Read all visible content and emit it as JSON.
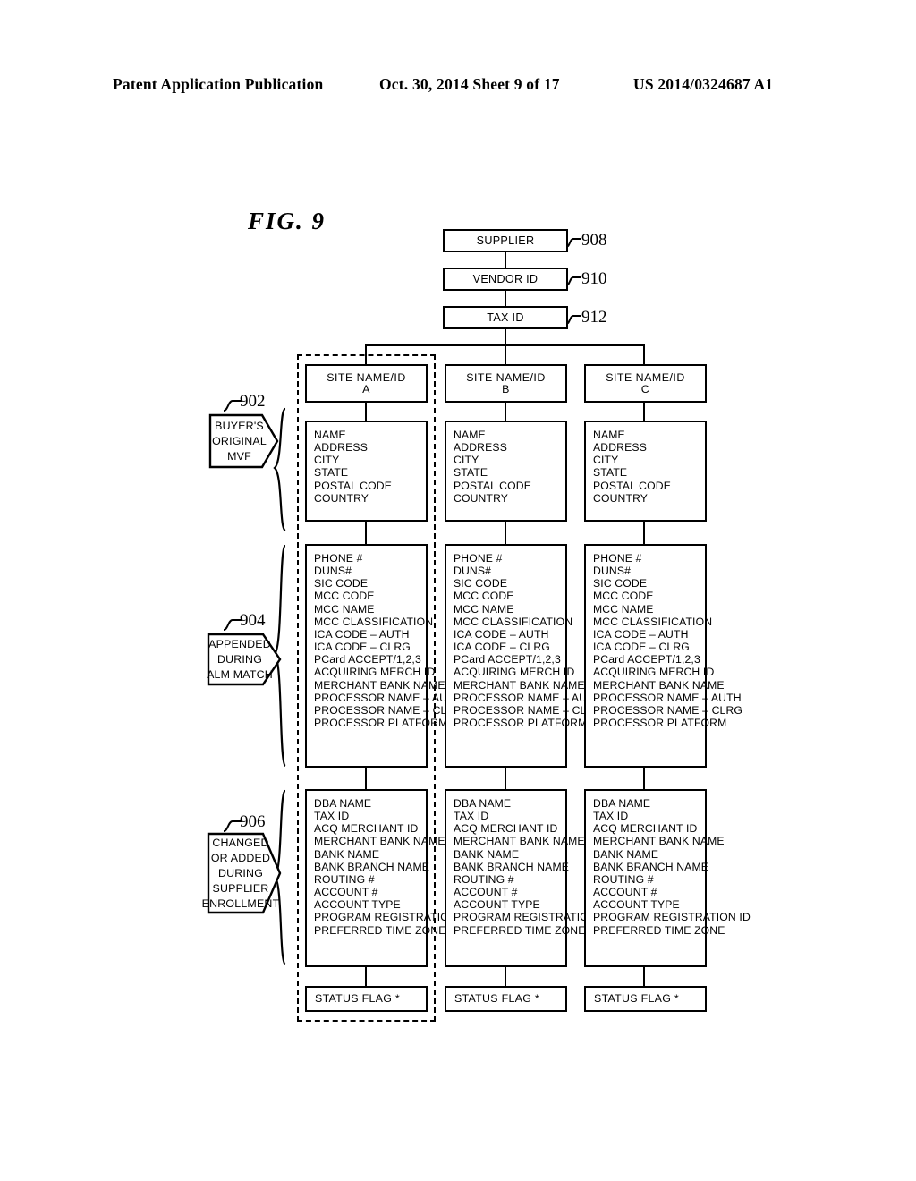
{
  "header": {
    "publication": "Patent Application Publication",
    "date_sheet": "Oct. 30, 2014  Sheet 9 of 17",
    "patent_number": "US 2014/0324687 A1"
  },
  "figure": {
    "title": "FIG.  9"
  },
  "top_chain": [
    {
      "label": "SUPPLIER",
      "ref": "908"
    },
    {
      "label": "VENDOR ID",
      "ref": "910"
    },
    {
      "label": "TAX ID",
      "ref": "912"
    }
  ],
  "callouts": [
    {
      "ref": "902",
      "lines": [
        "BUYER'S",
        "ORIGINAL",
        "MVF"
      ]
    },
    {
      "ref": "904",
      "lines": [
        "APPENDED",
        "DURING",
        "ALM MATCH"
      ]
    },
    {
      "ref": "906",
      "lines": [
        "CHANGED",
        "OR ADDED",
        "DURING",
        "SUPPLIER",
        "ENROLLMENT"
      ]
    }
  ],
  "columns": [
    {
      "site_header": {
        "line1": "SITE NAME/ID",
        "line2": "A"
      },
      "original_fields": [
        "NAME",
        "ADDRESS",
        "CITY",
        "STATE",
        "POSTAL CODE",
        "COUNTRY"
      ],
      "appended_fields": [
        "PHONE #",
        "DUNS#",
        "SIC CODE",
        "MCC CODE",
        "MCC NAME",
        "MCC CLASSIFICATION",
        "ICA CODE – AUTH",
        "ICA CODE – CLRG",
        "PCard ACCEPT/1,2,3",
        "ACQUIRING MERCH ID",
        "MERCHANT BANK NAME",
        "PROCESSOR NAME – AUTH",
        "PROCESSOR NAME – CLRG",
        "PROCESSOR PLATFORM"
      ],
      "enrollment_fields": [
        "DBA NAME",
        "TAX ID",
        "ACQ MERCHANT ID",
        "MERCHANT BANK NAME",
        "BANK NAME",
        "BANK BRANCH NAME",
        "ROUTING #",
        "ACCOUNT #",
        "ACCOUNT TYPE",
        "PROGRAM REGISTRATION ID",
        "PREFERRED TIME ZONE"
      ],
      "status_flag": "STATUS FLAG *"
    },
    {
      "site_header": {
        "line1": "SITE NAME/ID",
        "line2": "B"
      },
      "original_fields": [
        "NAME",
        "ADDRESS",
        "CITY",
        "STATE",
        "POSTAL CODE",
        "COUNTRY"
      ],
      "appended_fields": [
        "PHONE #",
        "DUNS#",
        "SIC CODE",
        "MCC CODE",
        "MCC NAME",
        "MCC CLASSIFICATION",
        "ICA CODE – AUTH",
        "ICA CODE – CLRG",
        "PCard ACCEPT/1,2,3",
        "ACQUIRING MERCH ID",
        "MERCHANT BANK NAME",
        "PROCESSOR NAME – AUTH",
        "PROCESSOR NAME – CLRG",
        "PROCESSOR PLATFORM"
      ],
      "enrollment_fields": [
        "DBA NAME",
        "TAX ID",
        "ACQ MERCHANT ID",
        "MERCHANT BANK NAME",
        "BANK NAME",
        "BANK BRANCH NAME",
        "ROUTING #",
        "ACCOUNT #",
        "ACCOUNT TYPE",
        "PROGRAM REGISTRATION ID",
        "PREFERRED TIME ZONE"
      ],
      "status_flag": "STATUS FLAG *"
    },
    {
      "site_header": {
        "line1": "SITE NAME/ID",
        "line2": "C"
      },
      "original_fields": [
        "NAME",
        "ADDRESS",
        "CITY",
        "STATE",
        "POSTAL CODE",
        "COUNTRY"
      ],
      "appended_fields": [
        "PHONE #",
        "DUNS#",
        "SIC CODE",
        "MCC CODE",
        "MCC NAME",
        "MCC CLASSIFICATION",
        "ICA CODE – AUTH",
        "ICA CODE – CLRG",
        "PCard ACCEPT/1,2,3",
        "ACQUIRING MERCH ID",
        "MERCHANT BANK NAME",
        "PROCESSOR NAME – AUTH",
        "PROCESSOR NAME – CLRG",
        "PROCESSOR PLATFORM"
      ],
      "enrollment_fields": [
        "DBA NAME",
        "TAX ID",
        "ACQ MERCHANT ID",
        "MERCHANT BANK NAME",
        "BANK NAME",
        "BANK BRANCH NAME",
        "ROUTING #",
        "ACCOUNT #",
        "ACCOUNT TYPE",
        "PROGRAM REGISTRATION ID",
        "PREFERRED TIME ZONE"
      ],
      "status_flag": "STATUS FLAG *"
    }
  ]
}
